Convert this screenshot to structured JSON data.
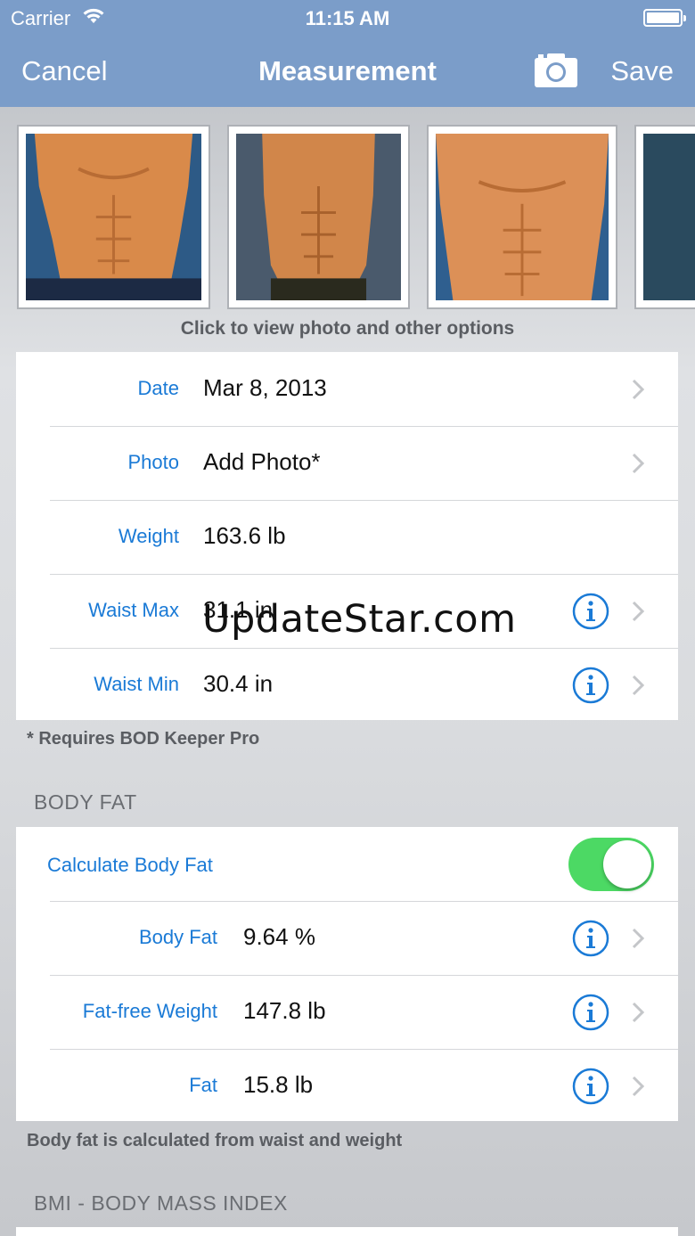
{
  "status_bar": {
    "carrier": "Carrier",
    "time": "11:15 AM"
  },
  "navbar": {
    "cancel_label": "Cancel",
    "title": "Measurement",
    "camera_icon": "camera-icon",
    "save_label": "Save",
    "color": "#7b9dc9"
  },
  "photos": {
    "caption": "Click to view photo and other options"
  },
  "measurements": [
    {
      "label": "Date",
      "value": "Mar 8, 2013"
    },
    {
      "label": "Photo",
      "value": "Add Photo*"
    },
    {
      "label": "Weight",
      "value": "163.6 lb"
    },
    {
      "label": "Waist Max",
      "value": "31.1 in"
    },
    {
      "label": "Waist Min",
      "value": "30.4 in"
    }
  ],
  "requires_note": "* Requires BOD Keeper Pro",
  "body_fat": {
    "header": "BODY FAT",
    "toggle_label": "Calculate Body Fat",
    "toggle_on": true,
    "rows": [
      {
        "label": "Body Fat",
        "value": "9.64 %"
      },
      {
        "label": "Fat-free Weight",
        "value": "147.8 lb"
      },
      {
        "label": "Fat",
        "value": "15.8 lb"
      }
    ],
    "footnote": "Body fat is calculated from waist and weight"
  },
  "bmi": {
    "header": "BMI - BODY MASS INDEX"
  },
  "watermark": "UpdateStar.com",
  "colors": {
    "accent": "#1a7ad6",
    "toggle_on": "#4cd964"
  }
}
